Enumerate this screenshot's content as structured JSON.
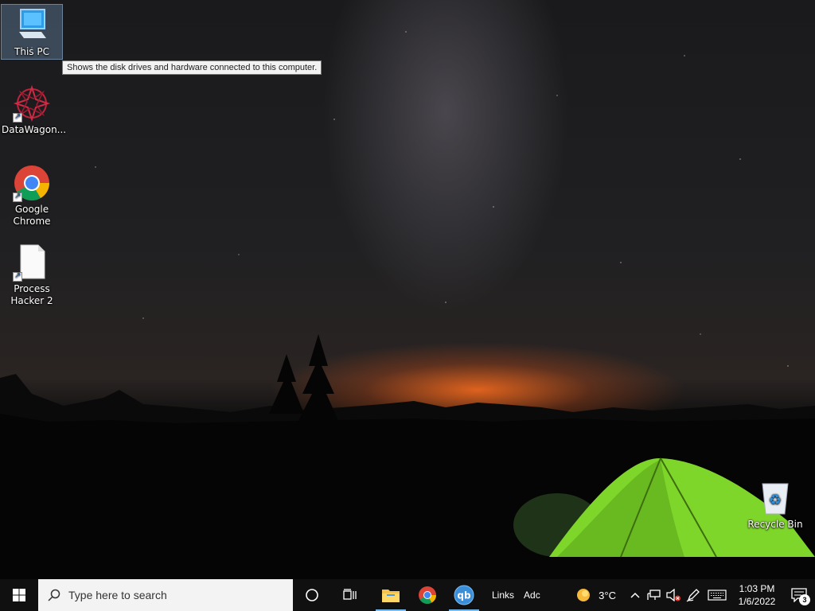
{
  "desktop": {
    "icons": [
      {
        "label": "This PC"
      },
      {
        "label": "DataWagon..."
      },
      {
        "label": "Google Chrome"
      },
      {
        "label": "Process Hacker 2"
      },
      {
        "label": "Recycle Bin"
      }
    ],
    "tooltip": "Shows the disk drives and hardware connected to this computer."
  },
  "taskbar": {
    "search_placeholder": "Type here to search",
    "toolbar_links": "Links",
    "toolbar_address": "Adc",
    "weather_temp": "3°C",
    "time": "1:03 PM",
    "date": "1/6/2022",
    "notification_count": "3"
  },
  "colors": {
    "taskbar_bg": "#101010",
    "accent": "#76b9ed",
    "tent": "#7fd62a"
  }
}
